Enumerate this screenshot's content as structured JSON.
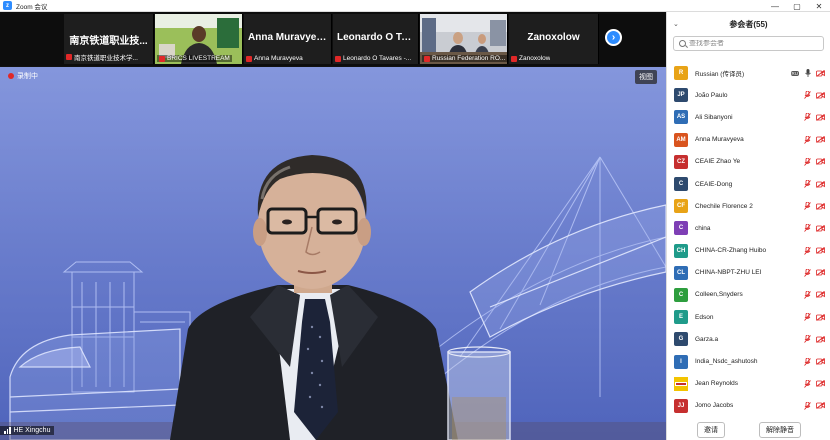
{
  "window": {
    "title": "Zoom 会议",
    "controls": {
      "minimize": "—",
      "maximize": "▢",
      "close": "✕"
    }
  },
  "thumbnails": [
    {
      "name": "南京铁道职业技...",
      "label": "南京铁道职业技术学..."
    },
    {
      "name": "",
      "label": "BRICS LIVESTREAM"
    },
    {
      "name": "Anna Muravyeva",
      "label": "Anna Muravyeva"
    },
    {
      "name": "Leonardo O Tav...",
      "label": "Leonardo O Tavares -..."
    },
    {
      "name": "",
      "label": "Russian Federation RO..."
    },
    {
      "name": "Zanoxolow",
      "label": "Zanoxolow"
    }
  ],
  "main_video": {
    "recording_label": "录制中",
    "view_button": "视图",
    "speaker": "HE Xingchu"
  },
  "panel": {
    "title": "参会者(55)",
    "search_placeholder": "查找参会者",
    "participants": [
      {
        "initials": "R",
        "color": "#e8a317",
        "name": "Russian (传译员)",
        "badge": "RU",
        "mic": "on"
      },
      {
        "initials": "JP",
        "color": "#2e4a6e",
        "name": "João Paulo",
        "badge": "",
        "mic": "off"
      },
      {
        "initials": "AS",
        "color": "#2f6db5",
        "name": "Ali Sibanyoni",
        "badge": "",
        "mic": "off"
      },
      {
        "initials": "AM",
        "color": "#d9541e",
        "name": "Anna Muravyeva",
        "badge": "",
        "mic": "off"
      },
      {
        "initials": "CZ",
        "color": "#c62f2f",
        "name": "CEAIE Zhao Ye",
        "badge": "",
        "mic": "off"
      },
      {
        "initials": "C",
        "color": "#2e4a6e",
        "name": "CEAIE-Dong",
        "badge": "",
        "mic": "off"
      },
      {
        "initials": "CF",
        "color": "#e8a317",
        "name": "Chechile Florence 2",
        "badge": "",
        "mic": "off"
      },
      {
        "initials": "C",
        "color": "#7e3fb5",
        "name": "china",
        "badge": "",
        "mic": "off"
      },
      {
        "initials": "CH",
        "color": "#1f9b8a",
        "name": "CHINA-CR-Zhang Huibo",
        "badge": "",
        "mic": "off"
      },
      {
        "initials": "CL",
        "color": "#2f6db5",
        "name": "CHINA-NBPT-ZHU LEI",
        "badge": "",
        "mic": "off"
      },
      {
        "initials": "C",
        "color": "#2e9e3e",
        "name": "Colleen,Snyders",
        "badge": "",
        "mic": "off"
      },
      {
        "initials": "E",
        "color": "#1f9b8a",
        "name": "Edson",
        "badge": "",
        "mic": "off"
      },
      {
        "initials": "G",
        "color": "#2e4a6e",
        "name": "Garza.a",
        "badge": "",
        "mic": "off"
      },
      {
        "initials": "I",
        "color": "#2f6db5",
        "name": "India_Nsdc_ashutosh",
        "badge": "",
        "mic": "off"
      },
      {
        "initials": "",
        "color": "#f3c400",
        "name": "Jean Reynolds",
        "badge": "",
        "mic": "off"
      },
      {
        "initials": "JJ",
        "color": "#c62f2f",
        "name": "Jomo Jacobs",
        "badge": "",
        "mic": "off"
      }
    ],
    "invite_button": "邀请",
    "unmute_all_button": "解除静音"
  }
}
